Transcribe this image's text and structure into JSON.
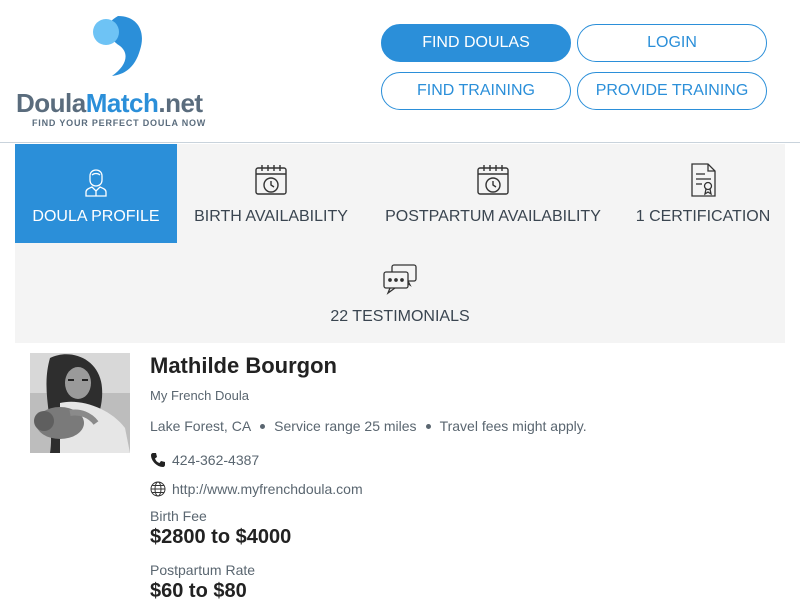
{
  "brand": {
    "name_main": "Doula",
    "name_accent": "Match",
    "name_suffix": ".net",
    "tagline": "FIND YOUR PERFECT DOULA NOW",
    "accent_color": "#2b8fd9"
  },
  "nav": {
    "find_doulas": "FIND DOULAS",
    "login": "LOGIN",
    "find_training": "FIND TRAINING",
    "provide_training": "PROVIDE TRAINING"
  },
  "tabs": [
    {
      "label": "DOULA PROFILE",
      "icon": "doula-person-icon",
      "active": true
    },
    {
      "label": "BIRTH AVAILABILITY",
      "icon": "calendar-clock-icon",
      "active": false
    },
    {
      "label": "POSTPARTUM AVAILABILITY",
      "icon": "calendar-clock-icon",
      "active": false
    },
    {
      "label": "1 CERTIFICATION",
      "icon": "certificate-icon",
      "active": false
    },
    {
      "label": "22 TESTIMONIALS",
      "icon": "chat-bubbles-icon",
      "active": false
    }
  ],
  "profile": {
    "name": "Mathilde Bourgon",
    "business": "My French Doula",
    "location": "Lake Forest, CA",
    "service_range": "Service range 25 miles",
    "travel_note": "Travel fees might apply.",
    "phone": "424-362-4387",
    "website": "http://www.myfrenchdoula.com",
    "birth_fee_label": "Birth Fee",
    "birth_fee": "$2800 to $4000",
    "postpartum_label": "Postpartum Rate",
    "postpartum_rate": "$60 to $80"
  }
}
